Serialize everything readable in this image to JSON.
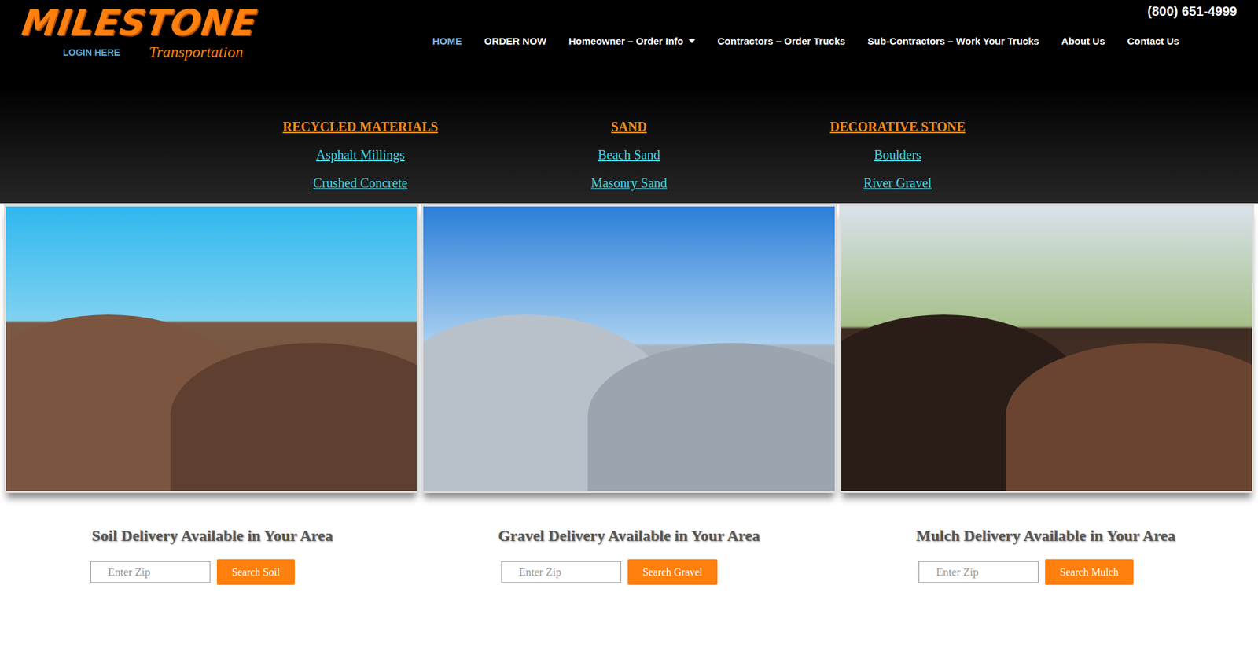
{
  "header": {
    "logo": {
      "name": "MILESTONE",
      "tagline": "Transportation"
    },
    "login": "LOGIN HERE",
    "phone": "(800) 651-4999",
    "nav": [
      {
        "label": "HOME",
        "selected": true,
        "kind": "link"
      },
      {
        "label": "ORDER NOW",
        "selected": false,
        "kind": "link"
      },
      {
        "label": "Homeowner – Order Info",
        "selected": false,
        "kind": "dropdown"
      },
      {
        "label": "Contractors – Order Trucks",
        "selected": false,
        "kind": "link"
      },
      {
        "label": "Sub-Contractors – Work Your Trucks",
        "selected": false,
        "kind": "link"
      },
      {
        "label": "About Us",
        "selected": false,
        "kind": "link"
      },
      {
        "label": "Contact Us",
        "selected": false,
        "kind": "link"
      }
    ]
  },
  "categories": [
    {
      "heading": "RECYCLED MATERIALS",
      "items": [
        "Asphalt Millings",
        "Crushed Concrete"
      ]
    },
    {
      "heading": "SAND",
      "items": [
        "Beach Sand",
        "Masonry Sand"
      ]
    },
    {
      "heading": "DECORATIVE STONE",
      "items": [
        "Boulders",
        "River Gravel"
      ]
    }
  ],
  "products": [
    {
      "title": "Soil Delivery Available in Your Area",
      "placeholder": "Enter Zip",
      "button": "Search Soil"
    },
    {
      "title": "Gravel Delivery Available in Your Area",
      "placeholder": "Enter Zip",
      "button": "Search Gravel"
    },
    {
      "title": "Mulch Delivery Available in Your Area",
      "placeholder": "Enter Zip",
      "button": "Search Mulch"
    }
  ]
}
